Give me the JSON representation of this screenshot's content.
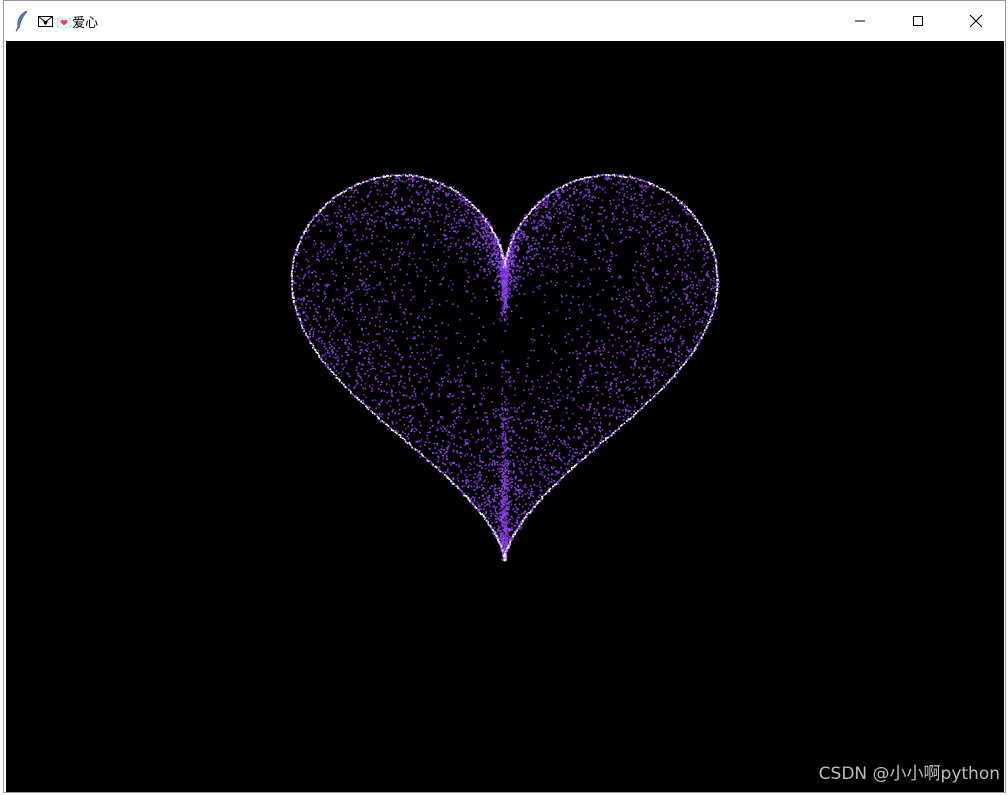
{
  "window": {
    "title": "💌爱心",
    "controls": [
      "minimize-icon",
      "maximize-icon",
      "close-icon"
    ]
  },
  "canvas": {
    "background_color": "#000000",
    "heart": {
      "particle_color": "#8f45e6",
      "particle_color_dim": "#6a2fc0",
      "outline_color": "#ffffff",
      "icon": "heart-icon"
    }
  },
  "watermark": {
    "text": "CSDN @小小啊python"
  }
}
